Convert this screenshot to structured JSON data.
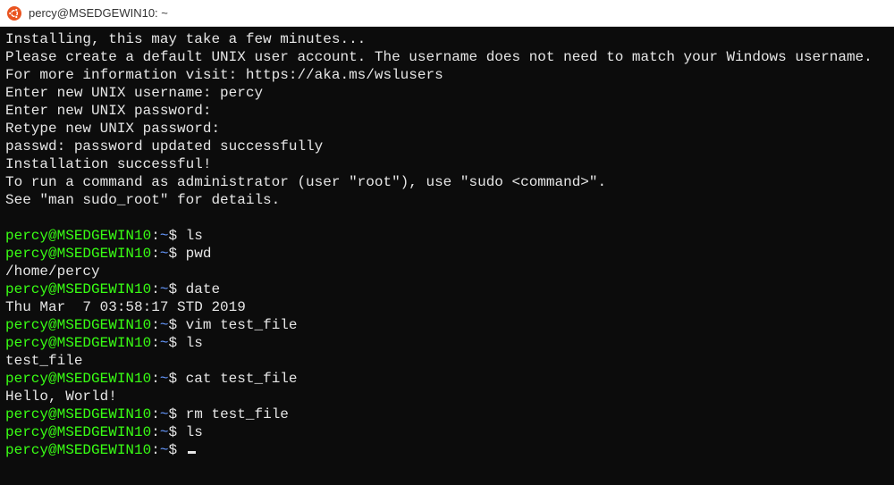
{
  "window": {
    "title": "percy@MSEDGEWIN10: ~"
  },
  "prompt": {
    "userhost": "percy@MSEDGEWIN10",
    "path": "~",
    "symbol": "$"
  },
  "lines": {
    "installing": "Installing, this may take a few minutes...",
    "create_account": "Please create a default UNIX user account. The username does not need to match your Windows username.",
    "more_info": "For more information visit: https://aka.ms/wslusers",
    "enter_username": "Enter new UNIX username: percy",
    "enter_password": "Enter new UNIX password:",
    "retype_password": "Retype new UNIX password:",
    "passwd_updated": "passwd: password updated successfully",
    "install_success": "Installation successful!",
    "sudo_run": "To run a command as administrator (user \"root\"), use \"sudo <command>\".",
    "sudo_see": "See \"man sudo_root\" for details.",
    "blank": " ",
    "cmd_ls1": "ls",
    "cmd_pwd": "pwd",
    "out_pwd": "/home/percy",
    "cmd_date": "date",
    "out_date": "Thu Mar  7 03:58:17 STD 2019",
    "cmd_vim": "vim test_file",
    "cmd_ls2": "ls",
    "out_ls2": "test_file",
    "cmd_cat": "cat test_file",
    "out_cat": "Hello, World!",
    "cmd_rm": "rm test_file",
    "cmd_ls3": "ls",
    "cmd_empty": ""
  }
}
